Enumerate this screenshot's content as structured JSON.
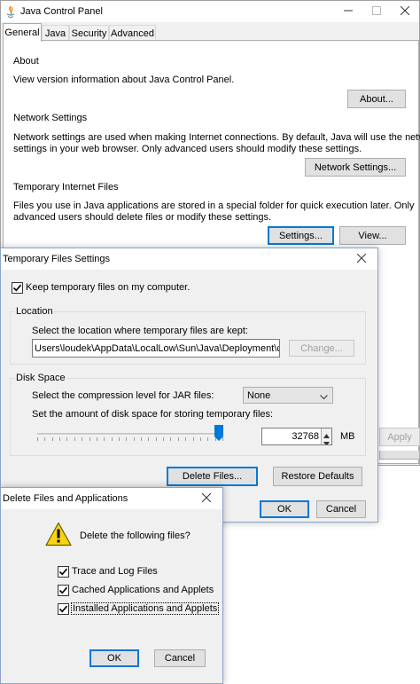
{
  "main": {
    "title": "Java Control Panel",
    "tabs": [
      {
        "label": "General"
      },
      {
        "label": "Java"
      },
      {
        "label": "Security"
      },
      {
        "label": "Advanced"
      }
    ],
    "about": {
      "heading": "About",
      "text": "View version information about Java Control Panel.",
      "button": "About..."
    },
    "network": {
      "heading": "Network Settings",
      "text_line1": "Network settings are used when making Internet connections. By default, Java will use the network",
      "text_line2": "settings in your web browser. Only advanced users should modify these settings.",
      "button": "Network Settings..."
    },
    "temp": {
      "heading": "Temporary Internet Files",
      "text_line1": "Files you use in Java applications are stored in a special folder for quick execution later. Only",
      "text_line2": "advanced users should delete files or modify these settings.",
      "settings_button": "Settings...",
      "view_button": "View..."
    },
    "apply_button": "Apply"
  },
  "temp_settings": {
    "title": "Temporary Files Settings",
    "keep_label": "Keep temporary files on my computer.",
    "keep_checked": true,
    "location": {
      "legend": "Location",
      "prompt": "Select the location where temporary files are kept:",
      "path": "Users\\loudek\\AppData\\LocalLow\\Sun\\Java\\Deployment\\cache",
      "change_button": "Change..."
    },
    "disk": {
      "legend": "Disk Space",
      "compression_label": "Select the compression level for JAR files:",
      "compression_value": "None",
      "amount_label": "Set the amount of disk space for storing temporary files:",
      "amount_value": "32768",
      "unit": "MB",
      "slider_fraction": 1.0
    },
    "delete_button": "Delete Files...",
    "restore_button": "Restore Defaults",
    "ok_button": "OK",
    "cancel_button": "Cancel"
  },
  "delete_dialog": {
    "title": "Delete Files and Applications",
    "prompt": "Delete the following files?",
    "options": [
      {
        "label": "Trace and Log Files",
        "checked": true
      },
      {
        "label": "Cached Applications and Applets",
        "checked": true
      },
      {
        "label": "Installed Applications and Applets",
        "checked": true
      }
    ],
    "ok_button": "OK",
    "cancel_button": "Cancel"
  },
  "colors": {
    "accent": "#0078d7",
    "warning_yellow": "#f8d313",
    "window_bg": "#f0f0f0"
  }
}
